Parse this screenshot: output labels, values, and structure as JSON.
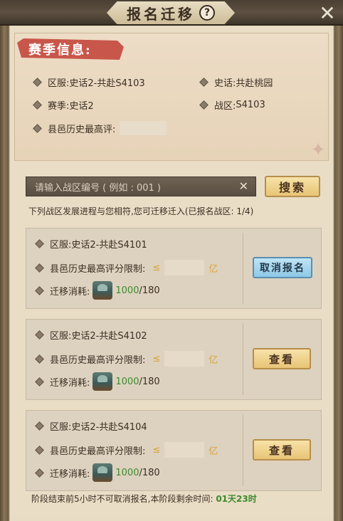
{
  "title": "报名迁移",
  "help_icon": "?",
  "close_icon": "✕",
  "season": {
    "tag": "赛季信息:",
    "server_label": "区服:",
    "server_value": "史话2-共赴S4103",
    "story_label": "史话:",
    "story_value": "共赴桃园",
    "season_label": "赛季:",
    "season_value": "史话2",
    "zone_label": "战区:",
    "zone_value": "S4103",
    "best_label": "县邑历史最高评:"
  },
  "search": {
    "placeholder": "请输入战区编号 ( 例如 : 001 )",
    "clear_icon": "✕",
    "button_label": "搜索"
  },
  "notice": "下列战区发展进程与您相符,您可迁移迁入(已报名战区: 1/4)",
  "cards": [
    {
      "server_label": "区服:",
      "server_value": "史话2-共赴S4101",
      "limit_label": "县邑历史最高评分限制:",
      "leq": "≤",
      "unit": "亿",
      "cost_label": "迁移消耗:",
      "cost_have": "1000",
      "cost_need": "/180",
      "button_label": "取消报名",
      "button_type": "cancel"
    },
    {
      "server_label": "区服:",
      "server_value": "史话2-共赴S4102",
      "limit_label": "县邑历史最高评分限制:",
      "leq": "≤",
      "unit": "亿",
      "cost_label": "迁移消耗:",
      "cost_have": "1000",
      "cost_need": "/180",
      "button_label": "查看",
      "button_type": "view"
    },
    {
      "server_label": "区服:",
      "server_value": "史话2-共赴S4104",
      "limit_label": "县邑历史最高评分限制:",
      "leq": "≤",
      "unit": "亿",
      "cost_label": "迁移消耗:",
      "cost_have": "1000",
      "cost_need": "/180",
      "button_label": "查看",
      "button_type": "view"
    }
  ],
  "footer": {
    "text": "阶段结束前5小时不可取消报名,本阶段剩余时间:",
    "time": "01天23时"
  },
  "colors": {
    "accent_green": "#3d8a2e",
    "gold": "#d9a23a",
    "tag_red": "#c9564a",
    "cancel_blue": "#8ec9e6"
  }
}
